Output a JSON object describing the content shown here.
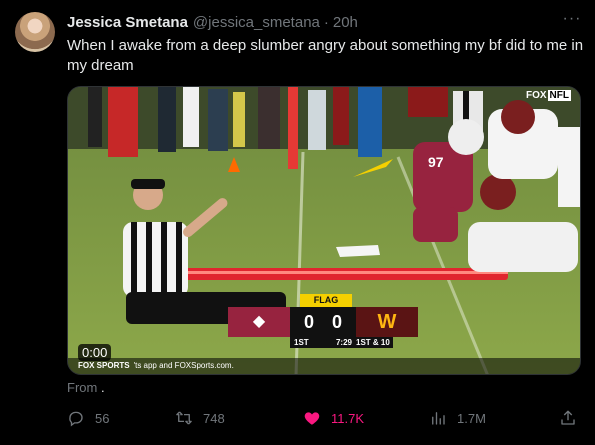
{
  "tweet": {
    "author_name": "Jessica Smetana",
    "handle": "@jessica_smetana",
    "separator": "·",
    "time": "20h",
    "text": "When I awake from a deep slumber angry about something my bf did to me in my dream",
    "more_icon": "ellipsis-icon"
  },
  "media": {
    "duration": "0:00",
    "caption_brand": "FOX SPORTS",
    "caption_text": "'ts app and FOXSports.com.",
    "network_logo_main": "FOX",
    "network_logo_tag": "NFL",
    "scorebug": {
      "flag": "FLAG",
      "home_score": "0",
      "away_score": "0",
      "quarter": "1ST",
      "clock": "7:29",
      "down": "1ST & 10",
      "home_color": "#97233f",
      "away_color": "#5a1414"
    }
  },
  "from_label": "From",
  "from_value": ".",
  "actions": {
    "replies": "56",
    "reposts": "748",
    "likes": "11.7K",
    "views": "1.7M",
    "like_color": "#f91880"
  }
}
